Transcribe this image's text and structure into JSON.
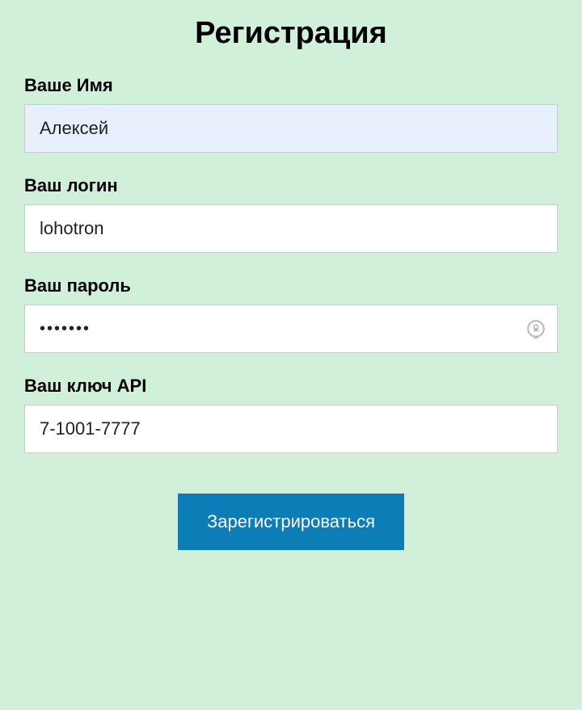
{
  "title": "Регистрация",
  "fields": {
    "name": {
      "label": "Ваше Имя",
      "value": "Алексей"
    },
    "login": {
      "label": "Ваш логин",
      "value": "lohotron"
    },
    "password": {
      "label": "Ваш пароль",
      "value": "•••••••"
    },
    "apiKey": {
      "label": "Ваш ключ API",
      "value": "7-1001-7777"
    }
  },
  "submit": {
    "label": "Зарегистрироваться"
  }
}
